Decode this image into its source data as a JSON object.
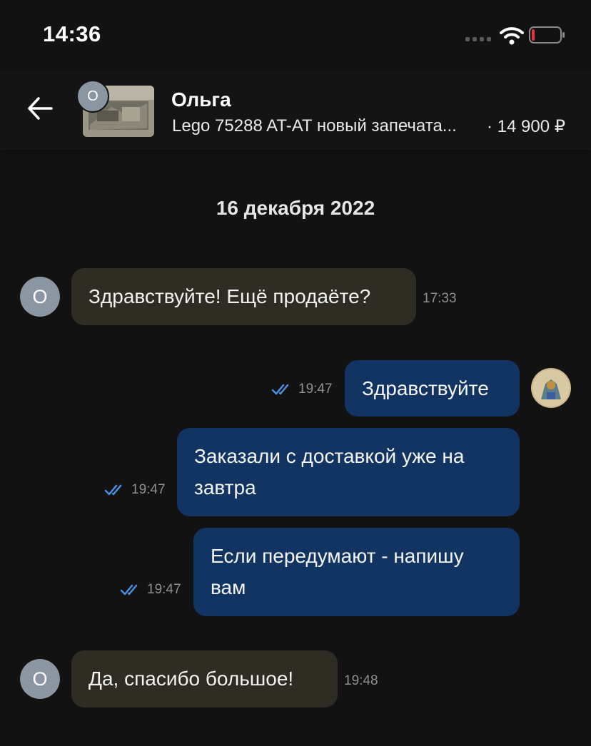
{
  "status_bar": {
    "time": "14:36"
  },
  "header": {
    "contact_name": "Ольга",
    "contact_initial": "О",
    "listing_title": "Lego 75288 AT-AT новый запечата...",
    "listing_price": "· 14 900 ₽"
  },
  "date_separator": "16 декабря 2022",
  "messages": [
    {
      "side": "incoming",
      "text": "Здравствуйте! Ещё продаёте?",
      "time": "17:33",
      "avatar_initial": "О"
    },
    {
      "side": "outgoing",
      "text": "Здравствуйте",
      "time": "19:47",
      "status": "read"
    },
    {
      "side": "outgoing",
      "text": "Заказали с доставкой уже на завтра",
      "time": "19:47",
      "status": "read"
    },
    {
      "side": "outgoing",
      "text": "Если передумают - напишу вам",
      "time": "19:47",
      "status": "read"
    },
    {
      "side": "incoming",
      "text": "Да, спасибо большое!",
      "time": "19:48",
      "avatar_initial": "О"
    }
  ],
  "colors": {
    "background": "#121212",
    "incoming_bubble": "#2f2c24",
    "outgoing_bubble": "#123462",
    "read_check": "#4a8fe0",
    "battery_low": "#e5333a"
  },
  "icons": [
    "signal-icon",
    "wifi-icon",
    "battery-icon",
    "back-arrow-icon",
    "double-check-icon"
  ]
}
